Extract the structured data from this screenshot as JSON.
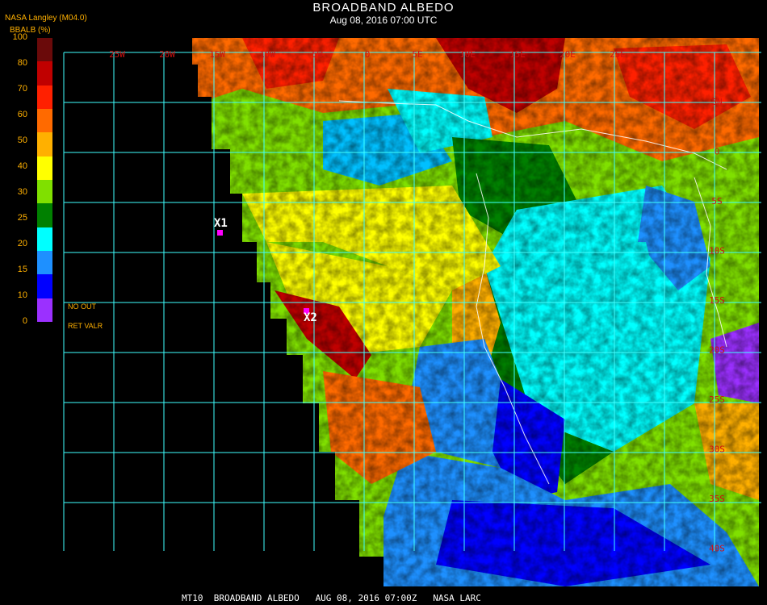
{
  "header": {
    "title": "BROADBAND ALBEDO",
    "subtitle": "Aug 08, 2016 07:00 UTC",
    "source": "NASA Langley (M04.0)",
    "product": "BBALB (%)"
  },
  "legend": {
    "ticks": [
      "100",
      "80",
      "70",
      "60",
      "50",
      "40",
      "30",
      "25",
      "20",
      "15",
      "10",
      "0"
    ],
    "colors": [
      "#6a0a0a",
      "#c00000",
      "#ff2000",
      "#ff6a00",
      "#ffb000",
      "#ffff00",
      "#80e000",
      "#008000",
      "#00ffff",
      "#1e90ff",
      "#0000ff",
      "#9b30ff"
    ],
    "note_line1": "NO    OUT",
    "note_line2": "RET   VALR"
  },
  "grid": {
    "color": "#40ffff",
    "longitude_labels": [
      "25W",
      "20W",
      "15W",
      "10W",
      "5W",
      "0",
      "5E",
      "10E",
      "15E",
      "20E",
      "25E"
    ],
    "latitude_labels": [
      "5N",
      "0",
      "5S",
      "10S",
      "15S",
      "20S",
      "25S",
      "30S",
      "35S",
      "40S"
    ]
  },
  "markers": [
    {
      "label": "X1",
      "color": "#ff00ff"
    },
    {
      "label": "X2",
      "color": "#ff00ff"
    }
  ],
  "footer": {
    "text": "MT10  BROADBAND ALBEDO   AUG 08, 2016 07:00Z   NASA LARC"
  }
}
